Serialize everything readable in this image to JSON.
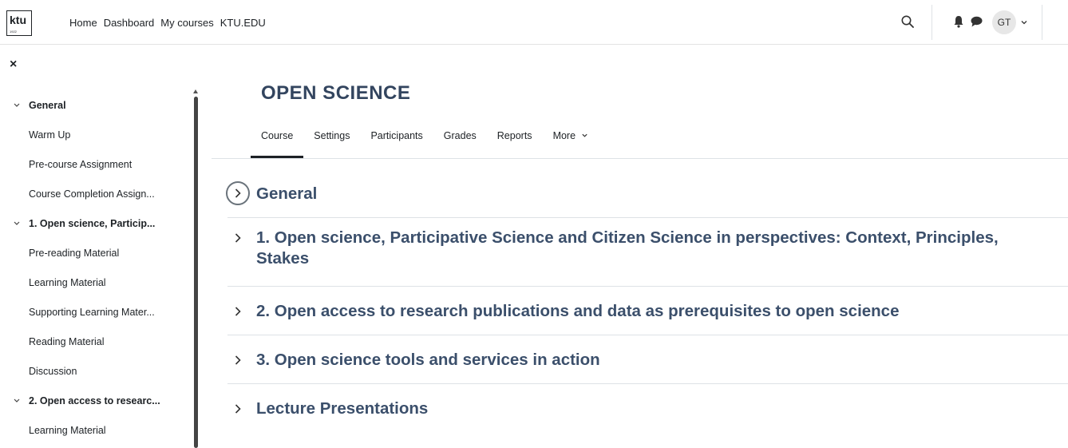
{
  "logo": {
    "text": "ktu",
    "year": "1922"
  },
  "primary_nav": [
    "Home",
    "Dashboard",
    "My courses",
    "KTU.EDU"
  ],
  "user": {
    "initials": "GT"
  },
  "drawer": {
    "close_label": "×",
    "items": [
      {
        "label": "General",
        "section": true
      },
      {
        "label": "Warm Up",
        "section": false
      },
      {
        "label": "Pre-course Assignment",
        "section": false
      },
      {
        "label": "Course Completion Assign...",
        "section": false
      },
      {
        "label": "1. Open science, Particip...",
        "section": true
      },
      {
        "label": "Pre-reading Material",
        "section": false
      },
      {
        "label": "Learning Material",
        "section": false
      },
      {
        "label": "Supporting Learning Mater...",
        "section": false
      },
      {
        "label": "Reading Material",
        "section": false
      },
      {
        "label": "Discussion",
        "section": false
      },
      {
        "label": "2. Open access to researc...",
        "section": true
      },
      {
        "label": "Learning Material",
        "section": false
      }
    ]
  },
  "course": {
    "title": "OPEN SCIENCE",
    "tabs": [
      "Course",
      "Settings",
      "Participants",
      "Grades",
      "Reports",
      "More"
    ],
    "sections": [
      {
        "title_lines": [
          "General"
        ]
      },
      {
        "title_lines": [
          "1. Open science, Participative Science and Citizen Science in perspectives: Context, Principles,",
          "Stakes"
        ]
      },
      {
        "title_lines": [
          "2. Open access to research publications and data as prerequisites to open science"
        ]
      },
      {
        "title_lines": [
          "3. Open science tools and services in action"
        ]
      },
      {
        "title_lines": [
          "Lecture Presentations"
        ]
      }
    ]
  },
  "colors": {
    "accent_title": "#33455f",
    "section_title": "#3b4f6b",
    "text": "#1d2125",
    "scrollbar": "#444444"
  }
}
